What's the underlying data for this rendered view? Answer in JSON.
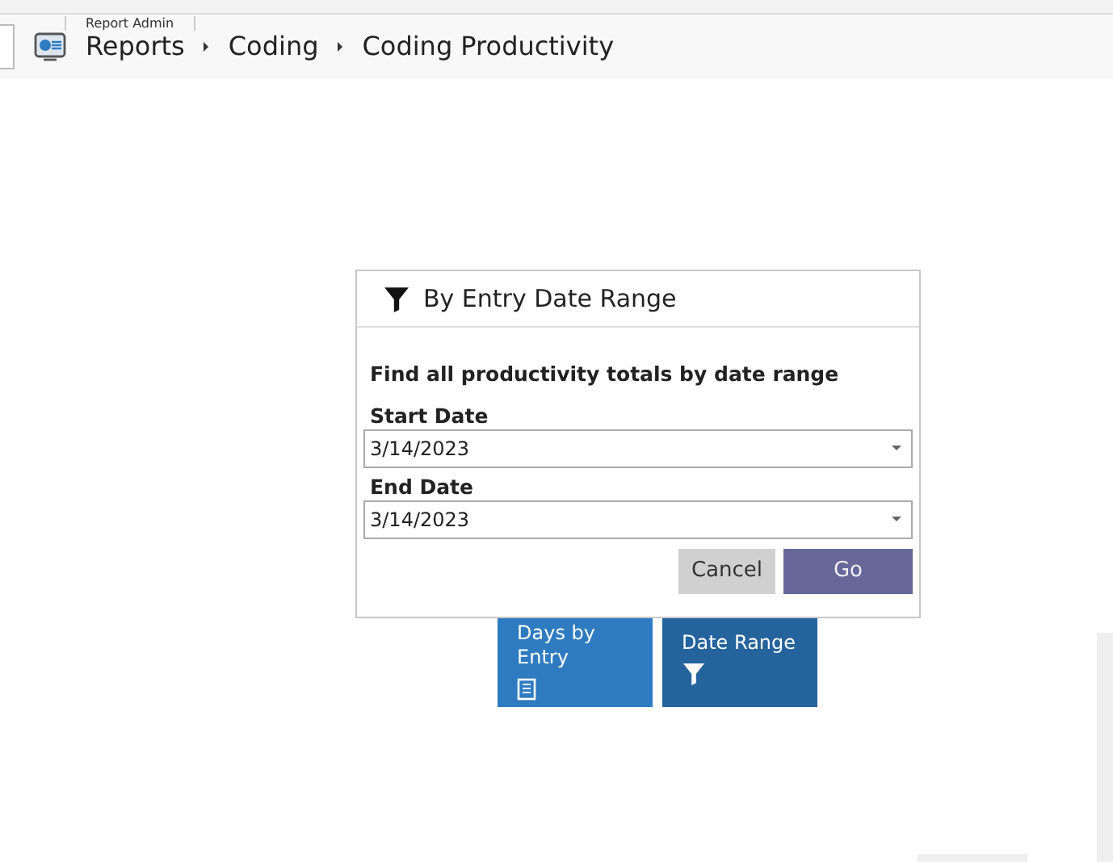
{
  "top_tab": {
    "label": "Report Admin"
  },
  "breadcrumb": [
    "Reports",
    "Coding",
    "Coding Productivity"
  ],
  "tiles": [
    {
      "label": "Days by Entry",
      "kind": "document"
    },
    {
      "label": "Date Range",
      "kind": "filter"
    }
  ],
  "dialog": {
    "title": "By Entry Date Range",
    "description": "Find all productivity totals by date range",
    "fields": [
      {
        "label": "Start Date",
        "value": "3/14/2023"
      },
      {
        "label": "End Date",
        "value": "3/14/2023"
      }
    ],
    "buttons": [
      {
        "label": "Cancel",
        "kind": "secondary"
      },
      {
        "label": "Go",
        "kind": "primary"
      }
    ]
  }
}
